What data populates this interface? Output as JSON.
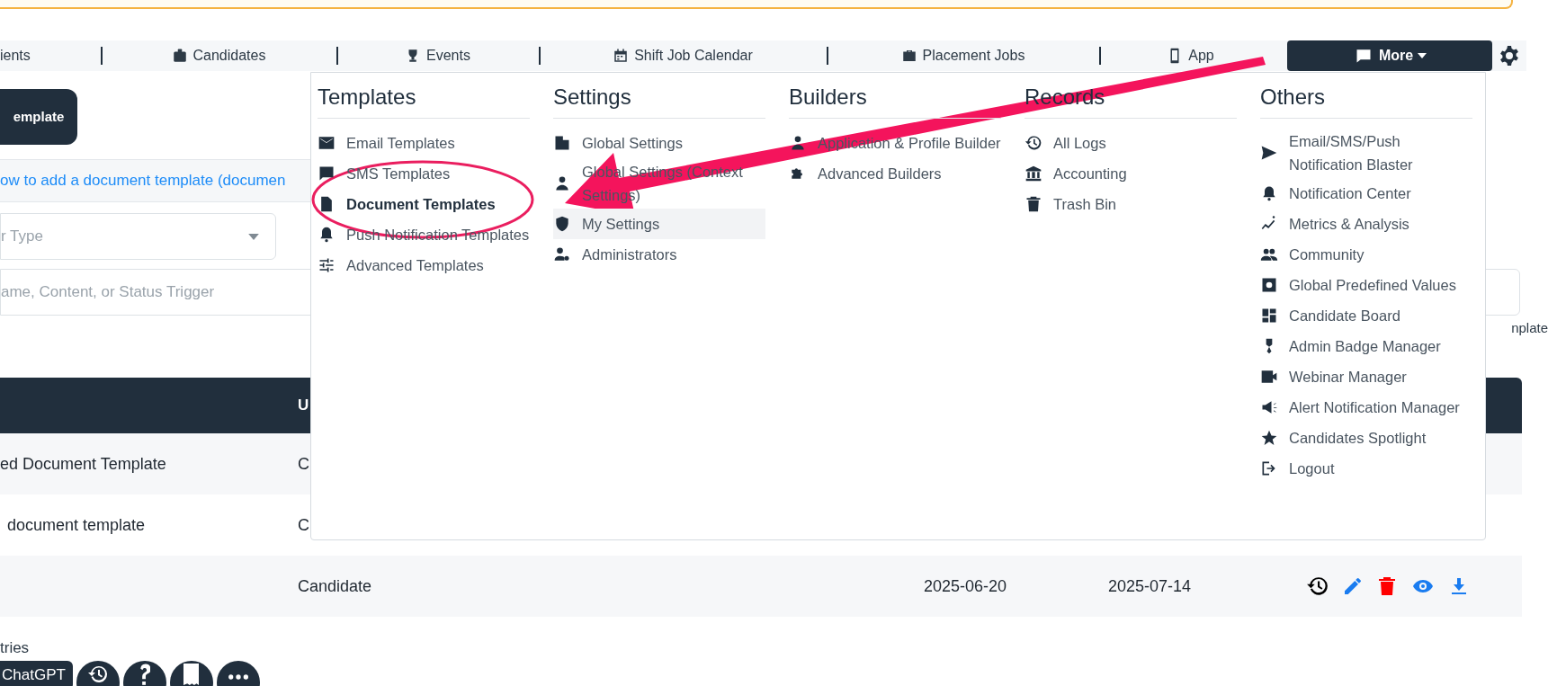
{
  "nav": {
    "items": [
      {
        "label": "ients"
      },
      {
        "label": "Candidates"
      },
      {
        "label": "Events"
      },
      {
        "label": "Shift Job Calendar"
      },
      {
        "label": "Placement Jobs"
      },
      {
        "label": "App"
      }
    ],
    "more_button": "More"
  },
  "page": {
    "add_button": "emplate",
    "help_link": "ow to add a document template (documen",
    "type_select": {
      "placeholder": "r Type"
    },
    "search": {
      "placeholder": "ame, Content, or Status Trigger"
    },
    "side_label": "nplate",
    "footer": "tries"
  },
  "table": {
    "header": [
      "U"
    ],
    "rows": [
      {
        "cells": [
          "ed Document Template",
          "C",
          "",
          ""
        ],
        "actions": false
      },
      {
        "cells": [
          "document template",
          "C",
          "",
          ""
        ],
        "actions": false
      },
      {
        "cells": [
          "",
          "Candidate",
          "2025-06-20",
          "2025-07-14"
        ],
        "actions": true
      }
    ]
  },
  "dropdown": {
    "columns": [
      {
        "title": "Templates",
        "items": [
          {
            "label": "Email Templates",
            "selected": false,
            "highlighted": false
          },
          {
            "label": "SMS Templates",
            "selected": false,
            "highlighted": false
          },
          {
            "label": "Document Templates",
            "selected": true,
            "highlighted": false
          },
          {
            "label": "Push Notification Templates",
            "selected": false,
            "highlighted": false
          },
          {
            "label": "Advanced Templates",
            "selected": false,
            "highlighted": false
          }
        ]
      },
      {
        "title": "Settings",
        "items": [
          {
            "label": "Global Settings",
            "selected": false,
            "highlighted": false
          },
          {
            "label": "Global Settings (Context Settings)",
            "selected": false,
            "highlighted": false
          },
          {
            "label": "My Settings",
            "selected": false,
            "highlighted": true
          },
          {
            "label": "Administrators",
            "selected": false,
            "highlighted": false
          }
        ]
      },
      {
        "title": "Builders",
        "items": [
          {
            "label": "Application & Profile Builder",
            "selected": false,
            "highlighted": false
          },
          {
            "label": "Advanced Builders",
            "selected": false,
            "highlighted": false
          }
        ]
      },
      {
        "title": "Records",
        "items": [
          {
            "label": "All Logs",
            "selected": false,
            "highlighted": false
          },
          {
            "label": "Accounting",
            "selected": false,
            "highlighted": false
          },
          {
            "label": "Trash Bin",
            "selected": false,
            "highlighted": false
          }
        ]
      },
      {
        "title": "Others",
        "items": [
          {
            "label": "Email/SMS/Push Notification Blaster",
            "selected": false,
            "highlighted": false
          },
          {
            "label": "Notification Center",
            "selected": false,
            "highlighted": false
          },
          {
            "label": "Metrics & Analysis",
            "selected": false,
            "highlighted": false
          },
          {
            "label": "Community",
            "selected": false,
            "highlighted": false
          },
          {
            "label": "Global Predefined Values",
            "selected": false,
            "highlighted": false
          },
          {
            "label": "Candidate Board",
            "selected": false,
            "highlighted": false
          },
          {
            "label": "Admin Badge Manager",
            "selected": false,
            "highlighted": false
          },
          {
            "label": "Webinar Manager",
            "selected": false,
            "highlighted": false
          },
          {
            "label": "Alert Notification Manager",
            "selected": false,
            "highlighted": false
          },
          {
            "label": "Candidates Spotlight",
            "selected": false,
            "highlighted": false
          },
          {
            "label": "Logout",
            "selected": false,
            "highlighted": false
          }
        ]
      }
    ]
  },
  "floating": {
    "chat_button": "ChatGPT"
  }
}
